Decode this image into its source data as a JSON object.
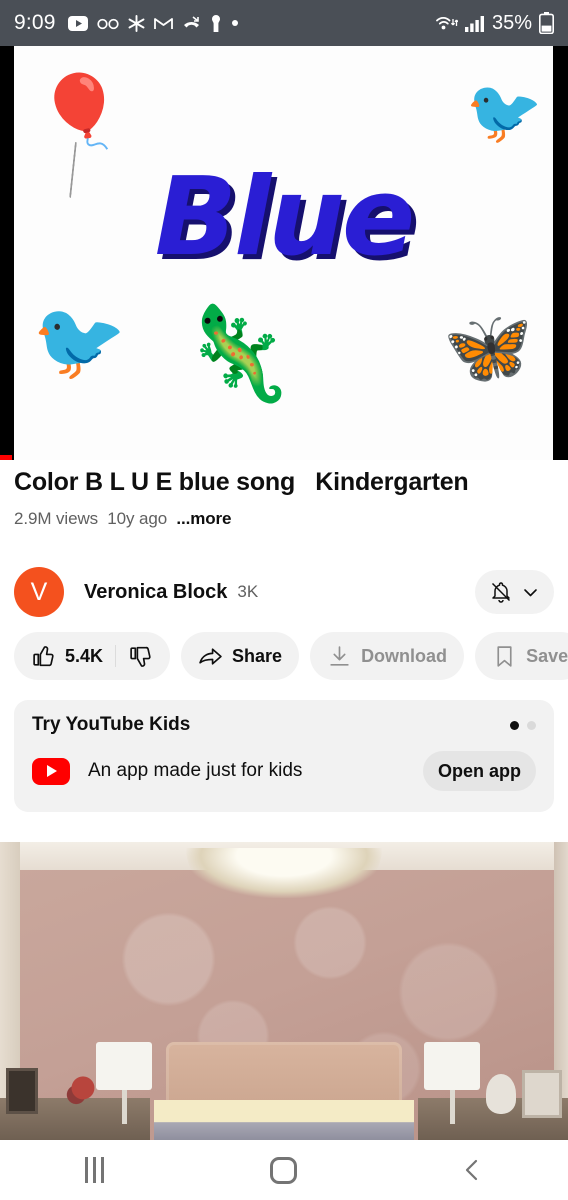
{
  "status_bar": {
    "time": "9:09",
    "left_icons": [
      "youtube-icon",
      "voicemail-icon",
      "asterisk-icon",
      "gmail-icon",
      "missed-call-icon",
      "key-icon",
      "dot-icon"
    ],
    "battery_percent": "35%",
    "right_icons": [
      "wifi-icon",
      "signal-icon",
      "battery-icon"
    ]
  },
  "player": {
    "video_word": "Blue",
    "objects": [
      "mouse-balloon",
      "bird-top-right",
      "bird-bottom-left",
      "lizard",
      "butterfly"
    ],
    "progress_label": ""
  },
  "video": {
    "title": "Color B L U E blue song   Kindergarten",
    "views": "2.9M views",
    "age": "10y ago",
    "more": "...more"
  },
  "channel": {
    "avatar_letter": "V",
    "avatar_color": "#f4511e",
    "name": "Veronica Block",
    "subscribers": "3K",
    "notification_state": "bell-off"
  },
  "actions": [
    {
      "name": "like",
      "label": "5.4K",
      "icon": "thumb-up-icon",
      "dim": false
    },
    {
      "name": "dislike",
      "label": "",
      "icon": "thumb-down-icon",
      "dim": false
    },
    {
      "name": "share",
      "label": "Share",
      "icon": "share-icon",
      "dim": false
    },
    {
      "name": "download",
      "label": "Download",
      "icon": "download-icon",
      "dim": true
    },
    {
      "name": "save",
      "label": "Save",
      "icon": "bookmark-icon",
      "dim": true
    }
  ],
  "promo": {
    "title": "Try YouTube Kids",
    "description": "An app made just for kids",
    "button_label": "Open app",
    "page_dots": 2,
    "active_dot": 0,
    "icon": "youtube-kids-icon"
  },
  "next_video": {
    "thumbnail_description": "bedroom-with-pink-damask-wallpaper"
  },
  "navbar": {
    "recents_label": "Recents",
    "home_label": "Home",
    "back_label": "Back"
  },
  "colors": {
    "brand_red": "#ff0000",
    "status_bar_bg": "#4a4f56",
    "pill_bg": "#f2f2f2",
    "text_primary": "#0f0f0f",
    "text_secondary": "#606060"
  }
}
